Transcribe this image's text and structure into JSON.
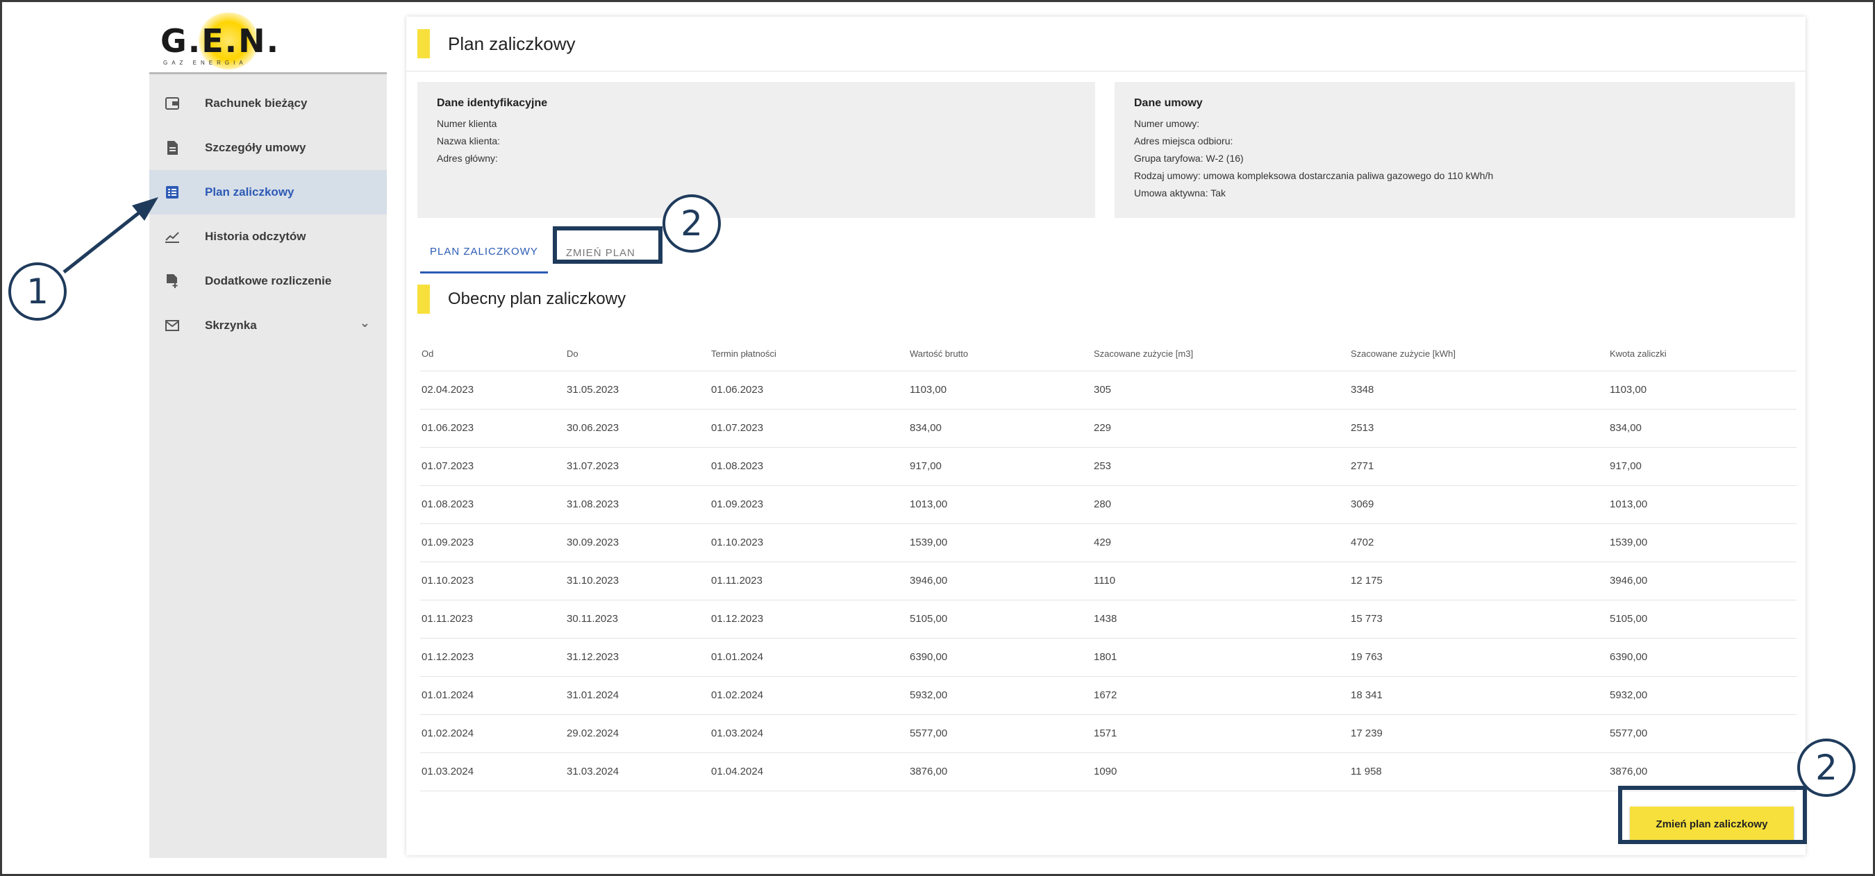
{
  "logo": {
    "brand": "G.E.N.",
    "tagline": "GAZ ENERGIA"
  },
  "sidebar": {
    "items": [
      {
        "label": "Rachunek bieżący",
        "icon": "wallet-icon"
      },
      {
        "label": "Szczegóły umowy",
        "icon": "document-icon"
      },
      {
        "label": "Plan zaliczkowy",
        "icon": "list-icon",
        "active": true
      },
      {
        "label": "Historia odczytów",
        "icon": "chart-line-icon"
      },
      {
        "label": "Dodatkowe rozliczenie",
        "icon": "document-plus-icon"
      },
      {
        "label": "Skrzynka",
        "icon": "mail-icon",
        "expandable": true
      }
    ]
  },
  "header": {
    "title": "Plan zaliczkowy"
  },
  "identification": {
    "title": "Dane identyfikacyjne",
    "rows": [
      {
        "label": "Numer klienta",
        "value": ""
      },
      {
        "label": "Nazwa klienta:",
        "value": ""
      },
      {
        "label": "Adres główny:",
        "value": ""
      }
    ]
  },
  "contract": {
    "title": "Dane umowy",
    "rows": [
      {
        "label": "Numer umowy:",
        "value": ""
      },
      {
        "label": "Adres miejsca odbioru:",
        "value": ""
      },
      {
        "label": "Grupa taryfowa:",
        "value": "W-2 (16)"
      },
      {
        "label": "Rodzaj umowy:",
        "value": "umowa kompleksowa dostarczania paliwa gazowego do 110 kWh/h"
      },
      {
        "label": "Umowa aktywna:",
        "value": "Tak"
      }
    ]
  },
  "tabs": [
    "PLAN ZALICZKOWY",
    "ZMIEŃ PLAN"
  ],
  "current_plan": {
    "title": "Obecny plan zaliczkowy",
    "columns": [
      "Od",
      "Do",
      "Termin płatności",
      "Wartość brutto",
      "Szacowane zużycie [m3]",
      "Szacowane zużycie [kWh]",
      "Kwota zaliczki"
    ],
    "rows": [
      [
        "02.04.2023",
        "31.05.2023",
        "01.06.2023",
        "1103,00",
        "305",
        "3348",
        "1103,00"
      ],
      [
        "01.06.2023",
        "30.06.2023",
        "01.07.2023",
        "834,00",
        "229",
        "2513",
        "834,00"
      ],
      [
        "01.07.2023",
        "31.07.2023",
        "01.08.2023",
        "917,00",
        "253",
        "2771",
        "917,00"
      ],
      [
        "01.08.2023",
        "31.08.2023",
        "01.09.2023",
        "1013,00",
        "280",
        "3069",
        "1013,00"
      ],
      [
        "01.09.2023",
        "30.09.2023",
        "01.10.2023",
        "1539,00",
        "429",
        "4702",
        "1539,00"
      ],
      [
        "01.10.2023",
        "31.10.2023",
        "01.11.2023",
        "3946,00",
        "1110",
        "12 175",
        "3946,00"
      ],
      [
        "01.11.2023",
        "30.11.2023",
        "01.12.2023",
        "5105,00",
        "1438",
        "15 773",
        "5105,00"
      ],
      [
        "01.12.2023",
        "31.12.2023",
        "01.01.2024",
        "6390,00",
        "1801",
        "19 763",
        "6390,00"
      ],
      [
        "01.01.2024",
        "31.01.2024",
        "01.02.2024",
        "5932,00",
        "1672",
        "18 341",
        "5932,00"
      ],
      [
        "01.02.2024",
        "29.02.2024",
        "01.03.2024",
        "5577,00",
        "1571",
        "17 239",
        "5577,00"
      ],
      [
        "01.03.2024",
        "31.03.2024",
        "01.04.2024",
        "3876,00",
        "1090",
        "11 958",
        "3876,00"
      ]
    ]
  },
  "change_button": {
    "label": "Zmień plan zaliczkowy"
  },
  "annotations": {
    "one": "1",
    "two": "2"
  },
  "colors": {
    "accent_yellow": "#f7e03c",
    "active_blue": "#2d5bb5",
    "annotation_navy": "#1f3b5c"
  }
}
